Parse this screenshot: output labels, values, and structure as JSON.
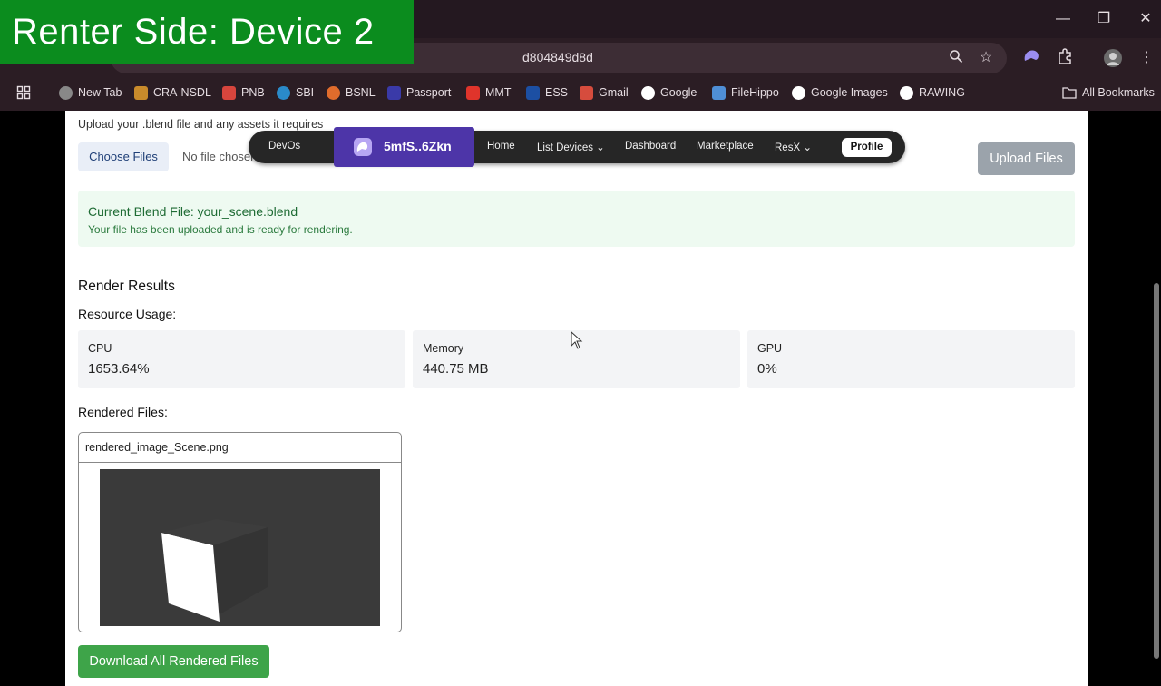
{
  "overlay": {
    "label": "Renter Side: Device 2"
  },
  "browser": {
    "address_text": "d804849d8d",
    "window_controls": {
      "minimize": "—",
      "restore": "❐",
      "close": "✕"
    },
    "bookmarks": [
      {
        "label": "New Tab",
        "color": "#888888"
      },
      {
        "label": "CRA-NSDL",
        "color": "#c98b2b"
      },
      {
        "label": "PNB",
        "color": "#d6453d"
      },
      {
        "label": "SBI",
        "color": "#2a8ac9"
      },
      {
        "label": "BSNL",
        "color": "#e06c2c"
      },
      {
        "label": "Passport",
        "color": "#3a3aa8"
      },
      {
        "label": "MMT",
        "color": "#e0342b"
      },
      {
        "label": "ESS",
        "color": "#1c4fa3"
      },
      {
        "label": "Gmail",
        "color": "#d64c3d"
      },
      {
        "label": "Google",
        "color": "#ffffff"
      },
      {
        "label": "FileHippo",
        "color": "#4f8fd6"
      },
      {
        "label": "Google Images",
        "color": "#ffffff"
      },
      {
        "label": "RAWING",
        "color": "#ffffff"
      }
    ],
    "all_bookmarks": "All Bookmarks"
  },
  "upload": {
    "hint": "Upload your .blend file and any assets it requires",
    "choose_label": "Choose Files",
    "no_file": "No file chosen",
    "upload_label": "Upload Files"
  },
  "current_blend": {
    "title": "Current Blend File: your_scene.blend",
    "subtitle": "Your file has been uploaded and is ready for rendering."
  },
  "navbar": {
    "brand": "DevOs",
    "wallet": "5mfS..6Zkn",
    "items": [
      "Home",
      "List Devices ⌄",
      "Dashboard",
      "Marketplace",
      "ResX ⌄"
    ],
    "profile": "Profile"
  },
  "results": {
    "heading": "Render Results",
    "usage_heading": "Resource Usage:",
    "usage": [
      {
        "label": "CPU",
        "value": "1653.64%"
      },
      {
        "label": "Memory",
        "value": "440.75 MB"
      },
      {
        "label": "GPU",
        "value": "0%"
      }
    ],
    "files_heading": "Rendered Files:",
    "file_name": "rendered_image_Scene.png",
    "download_label": "Download All Rendered Files"
  }
}
